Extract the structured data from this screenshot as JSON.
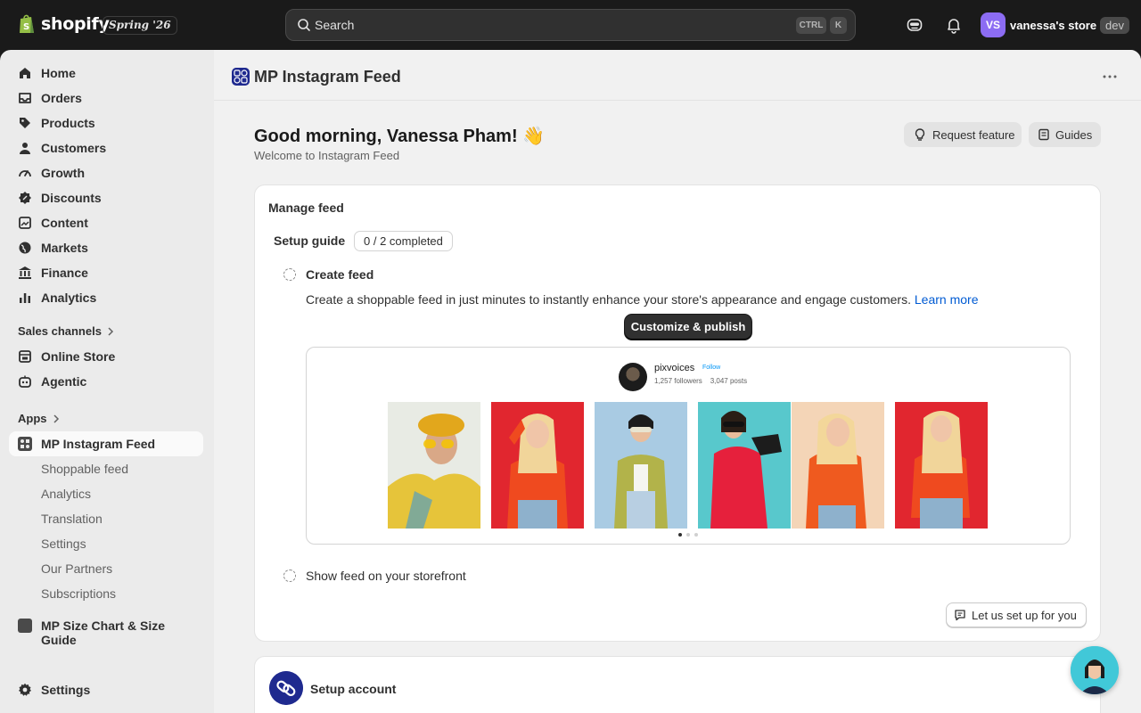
{
  "topbar": {
    "brand": "shopify",
    "version": "Spring '26",
    "search": {
      "placeholder": "Search",
      "shortcut_ctrl": "CTRL",
      "shortcut_key": "K"
    },
    "store": {
      "initials": "VS",
      "name": "vanessa's store",
      "badge": "dev"
    }
  },
  "sidebar": {
    "items": [
      {
        "label": "Home",
        "icon": "home-icon"
      },
      {
        "label": "Orders",
        "icon": "inbox-icon"
      },
      {
        "label": "Products",
        "icon": "tag-icon"
      },
      {
        "label": "Customers",
        "icon": "person-icon"
      },
      {
        "label": "Growth",
        "icon": "gauge-icon"
      },
      {
        "label": "Discounts",
        "icon": "discount-icon"
      },
      {
        "label": "Content",
        "icon": "content-icon"
      },
      {
        "label": "Markets",
        "icon": "globe-icon"
      },
      {
        "label": "Finance",
        "icon": "bank-icon"
      },
      {
        "label": "Analytics",
        "icon": "bar-chart-icon"
      }
    ],
    "sales_channels_label": "Sales channels",
    "sales_channels": [
      {
        "label": "Online Store",
        "icon": "store-icon"
      },
      {
        "label": "Agentic",
        "icon": "robot-icon"
      }
    ],
    "apps_label": "Apps",
    "active_app": "MP Instagram Feed",
    "app_subitems": [
      "Shoppable feed",
      "Analytics",
      "Translation",
      "Settings",
      "Our Partners",
      "Subscriptions"
    ],
    "other_app": "MP Size Chart & Size Guide",
    "settings": "Settings"
  },
  "app_header": {
    "title": "MP Instagram Feed"
  },
  "page": {
    "greeting": "Good morning, Vanessa Pham! 👋",
    "welcome": "Welcome to Instagram Feed",
    "request_feature": "Request feature",
    "guides": "Guides"
  },
  "manage_feed": {
    "title": "Manage feed",
    "setup_guide": "Setup guide",
    "progress": "0 / 2 completed",
    "step1_title": "Create feed",
    "step1_desc": "Create a shoppable feed in just minutes to instantly enhance your store's appearance and engage customers.",
    "learn_more": "Learn more",
    "customize_button": "Customize & publish",
    "preview": {
      "username": "pixvoices",
      "follow": "Follow",
      "followers": "1,257 followers",
      "posts": "3,047 posts"
    },
    "step2_title": "Show feed on your storefront",
    "setup_for_you": "Let us set up for you"
  },
  "setup_account": {
    "title": "Setup account"
  },
  "colors": {
    "topbar": "#1a1a1a",
    "accent_link": "#005bd3",
    "app_brand": "#1f2a8f",
    "avatar": "#8c6cf3"
  }
}
